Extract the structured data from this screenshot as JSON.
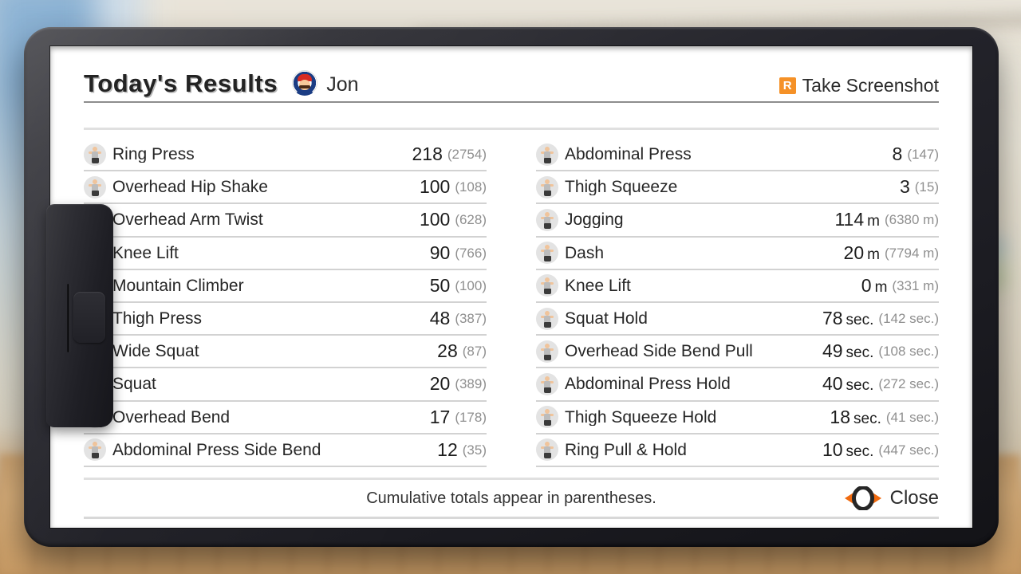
{
  "header": {
    "title": "Today's Results",
    "avatar_icon": "mario-avatar-icon",
    "username": "Jon",
    "screenshot_button": {
      "badge": "R",
      "label": "Take Screenshot",
      "badge_color": "#f59127"
    }
  },
  "results": {
    "left_column": [
      {
        "icon": "exercise-icon",
        "name": "Ring Press",
        "value": "218",
        "unit": "",
        "total": "(2754)"
      },
      {
        "icon": "exercise-icon",
        "name": "Overhead Hip Shake",
        "value": "100",
        "unit": "",
        "total": "(108)"
      },
      {
        "icon": "exercise-icon",
        "name": "Overhead Arm Twist",
        "value": "100",
        "unit": "",
        "total": "(628)"
      },
      {
        "icon": "exercise-icon",
        "name": "Knee Lift",
        "value": "90",
        "unit": "",
        "total": "(766)"
      },
      {
        "icon": "exercise-icon",
        "name": "Mountain Climber",
        "value": "50",
        "unit": "",
        "total": "(100)"
      },
      {
        "icon": "exercise-icon",
        "name": "Thigh Press",
        "value": "48",
        "unit": "",
        "total": "(387)"
      },
      {
        "icon": "exercise-icon",
        "name": "Wide Squat",
        "value": "28",
        "unit": "",
        "total": "(87)"
      },
      {
        "icon": "exercise-icon",
        "name": "Squat",
        "value": "20",
        "unit": "",
        "total": "(389)"
      },
      {
        "icon": "exercise-icon",
        "name": "Overhead Bend",
        "value": "17",
        "unit": "",
        "total": "(178)"
      },
      {
        "icon": "exercise-icon",
        "name": "Abdominal Press Side Bend",
        "value": "12",
        "unit": "",
        "total": "(35)"
      }
    ],
    "right_column": [
      {
        "icon": "exercise-icon",
        "name": "Abdominal Press",
        "value": "8",
        "unit": "",
        "total": "(147)"
      },
      {
        "icon": "exercise-icon",
        "name": "Thigh Squeeze",
        "value": "3",
        "unit": "",
        "total": "(15)"
      },
      {
        "icon": "exercise-icon",
        "name": "Jogging",
        "value": "114",
        "unit": "m",
        "total": "(6380 m)"
      },
      {
        "icon": "exercise-icon",
        "name": "Dash",
        "value": "20",
        "unit": "m",
        "total": "(7794 m)"
      },
      {
        "icon": "exercise-icon",
        "name": "Knee Lift",
        "value": "0",
        "unit": "m",
        "total": "(331 m)"
      },
      {
        "icon": "exercise-icon",
        "name": "Squat Hold",
        "value": "78",
        "unit": "sec.",
        "total": "(142 sec.)"
      },
      {
        "icon": "exercise-icon",
        "name": "Overhead Side Bend Pull",
        "value": "49",
        "unit": "sec.",
        "total": "(108 sec.)"
      },
      {
        "icon": "exercise-icon",
        "name": "Abdominal Press Hold",
        "value": "40",
        "unit": "sec.",
        "total": "(272 sec.)"
      },
      {
        "icon": "exercise-icon",
        "name": "Thigh Squeeze Hold",
        "value": "18",
        "unit": "sec.",
        "total": "(41 sec.)"
      },
      {
        "icon": "exercise-icon",
        "name": "Ring Pull & Hold",
        "value": "10",
        "unit": "sec.",
        "total": "(447 sec.)"
      }
    ]
  },
  "footer": {
    "note": "Cumulative totals appear in parentheses.",
    "close_label": "Close",
    "close_icon": "ring-con-icon",
    "ring_accent_color": "#f06a0f"
  }
}
